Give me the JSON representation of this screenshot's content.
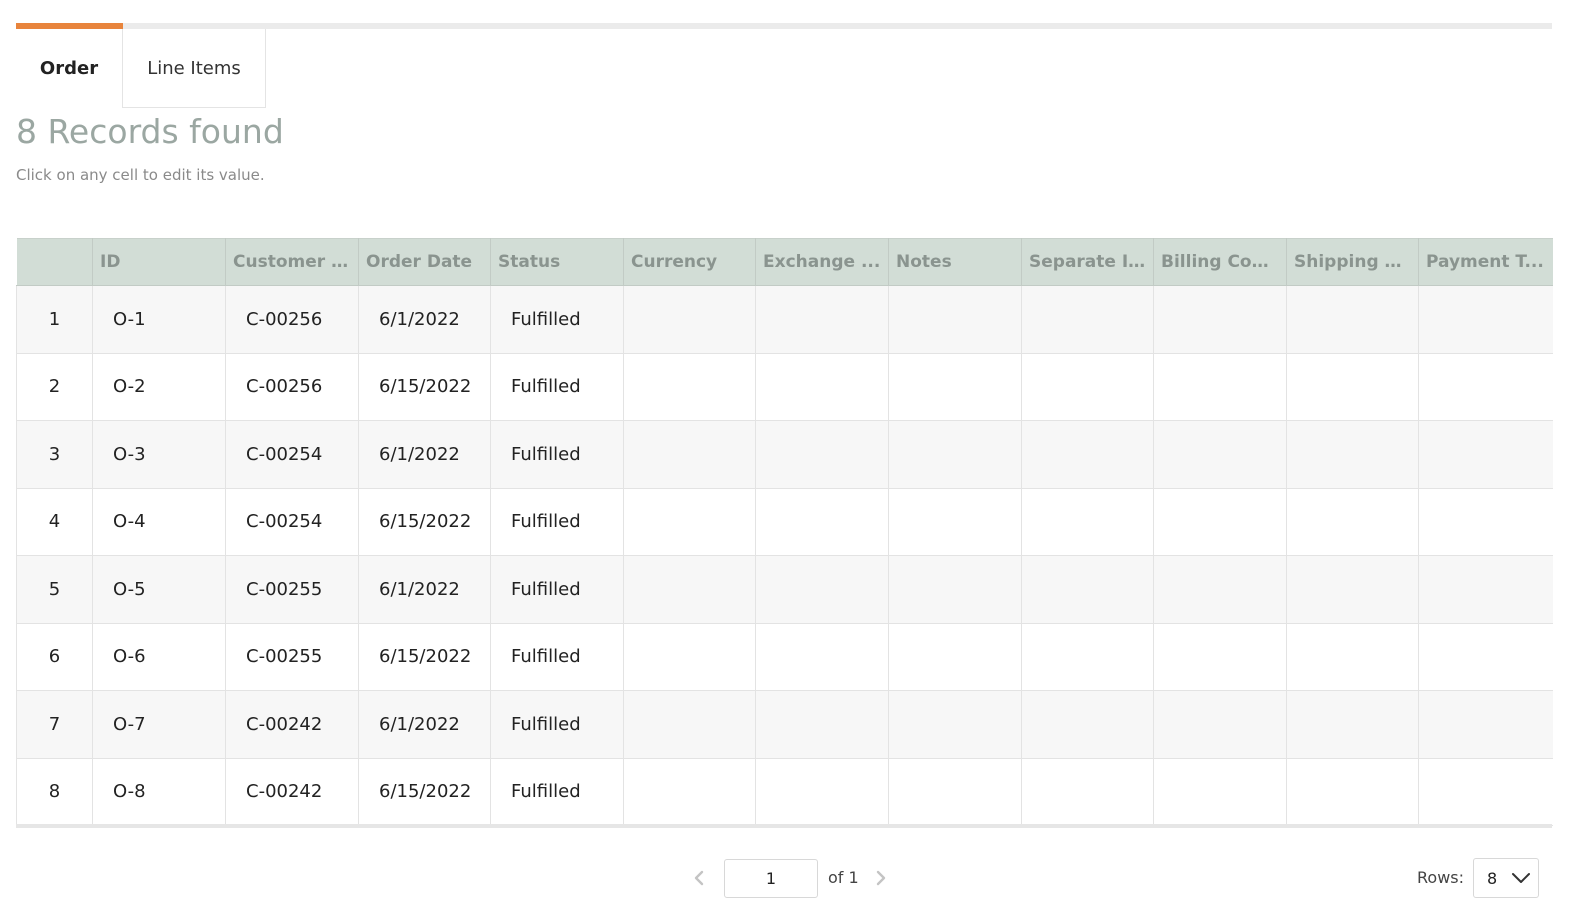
{
  "tabs": [
    {
      "label": "Order",
      "active": true
    },
    {
      "label": "Line Items",
      "active": false
    }
  ],
  "colors": {
    "accent": "#e8843c",
    "header_bg": "#d2ddd6",
    "title": "#9ba7a2"
  },
  "records": {
    "title": "8 Records found",
    "hint": "Click on any cell to edit its value."
  },
  "table": {
    "columns": [
      "",
      "ID",
      "Customer ID",
      "Order Date",
      "Status",
      "Currency",
      "Exchange ...",
      "Notes",
      "Separate I...",
      "Billing Con...",
      "Shipping C...",
      "Payment T..."
    ],
    "rows": [
      [
        "1",
        "O-1",
        "C-00256",
        "6/1/2022",
        "Fulfilled",
        "",
        "",
        "",
        "",
        "",
        "",
        ""
      ],
      [
        "2",
        "O-2",
        "C-00256",
        "6/15/2022",
        "Fulfilled",
        "",
        "",
        "",
        "",
        "",
        "",
        ""
      ],
      [
        "3",
        "O-3",
        "C-00254",
        "6/1/2022",
        "Fulfilled",
        "",
        "",
        "",
        "",
        "",
        "",
        ""
      ],
      [
        "4",
        "O-4",
        "C-00254",
        "6/15/2022",
        "Fulfilled",
        "",
        "",
        "",
        "",
        "",
        "",
        ""
      ],
      [
        "5",
        "O-5",
        "C-00255",
        "6/1/2022",
        "Fulfilled",
        "",
        "",
        "",
        "",
        "",
        "",
        ""
      ],
      [
        "6",
        "O-6",
        "C-00255",
        "6/15/2022",
        "Fulfilled",
        "",
        "",
        "",
        "",
        "",
        "",
        ""
      ],
      [
        "7",
        "O-7",
        "C-00242",
        "6/1/2022",
        "Fulfilled",
        "",
        "",
        "",
        "",
        "",
        "",
        ""
      ],
      [
        "8",
        "O-8",
        "C-00242",
        "6/15/2022",
        "Fulfilled",
        "",
        "",
        "",
        "",
        "",
        "",
        ""
      ]
    ]
  },
  "pager": {
    "page": "1",
    "of_label": "of 1",
    "rows_label": "Rows:",
    "rows_value": "8",
    "prev_icon": "chevron-left-icon",
    "next_icon": "chevron-right-icon"
  }
}
